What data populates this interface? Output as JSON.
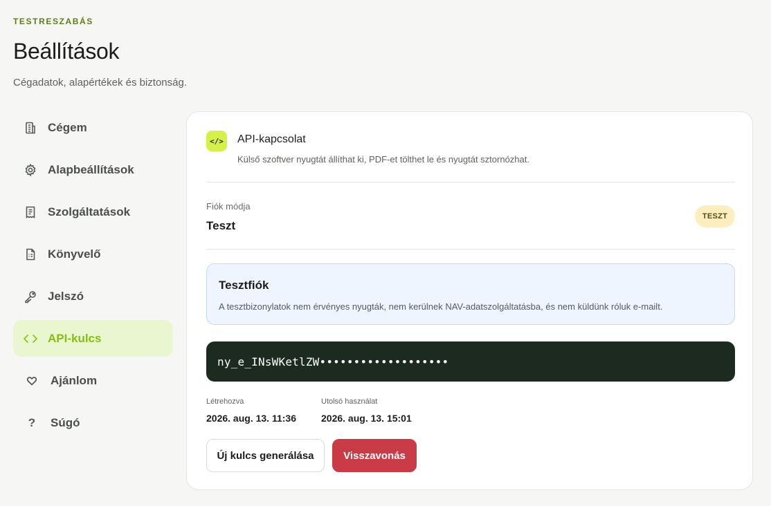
{
  "header": {
    "eyebrow": "TESTRESZABÁS",
    "title": "Beállítások",
    "subtitle": "Cégadatok, alapértékek és biztonság."
  },
  "sidebar": {
    "items": [
      {
        "label": "Cégem",
        "icon": "building-icon",
        "active": false
      },
      {
        "label": "Alapbeállítások",
        "icon": "gear-icon",
        "active": false
      },
      {
        "label": "Szolgáltatások",
        "icon": "document-list-icon",
        "active": false
      },
      {
        "label": "Könyvelő",
        "icon": "ledger-icon",
        "active": false
      },
      {
        "label": "Jelszó",
        "icon": "key-icon",
        "active": false
      },
      {
        "label": "API-kulcs",
        "icon": "code-icon",
        "active": true
      },
      {
        "label": "Ajánlom",
        "icon": "heart-icon",
        "active": false
      },
      {
        "label": "Súgó",
        "icon": "question-icon",
        "active": false
      }
    ]
  },
  "api": {
    "badge": "</>",
    "title": "API-kapcsolat",
    "description": "Külső szoftver nyugtát állíthat ki, PDF-et tölthet le és nyugtát sztornózhat."
  },
  "mode": {
    "label": "Fiók módja",
    "value": "Teszt",
    "badge": "TESZT"
  },
  "info": {
    "title": "Tesztfiók",
    "text": "A tesztbizonylatok nem érvényes nyugták, nem kerülnek NAV-adatszolgáltatásba, és nem küldünk róluk e-mailt."
  },
  "key": {
    "value": "ny_e_INsWKetlZW•••••••••••••••••••"
  },
  "meta": {
    "created_label": "Létrehozva",
    "created_value": "2026. aug. 13. 11:36",
    "last_used_label": "Utolsó használat",
    "last_used_value": "2026. aug. 13. 15:01"
  },
  "actions": {
    "regenerate_label": "Új kulcs generálása",
    "revoke_label": "Visszavonás"
  },
  "colors": {
    "accent": "#86bd16",
    "accent_bg": "#eaf6cf",
    "danger": "#c83b47",
    "key_bg": "#1d2a1f",
    "badge_yellow": "#fdeec0"
  }
}
